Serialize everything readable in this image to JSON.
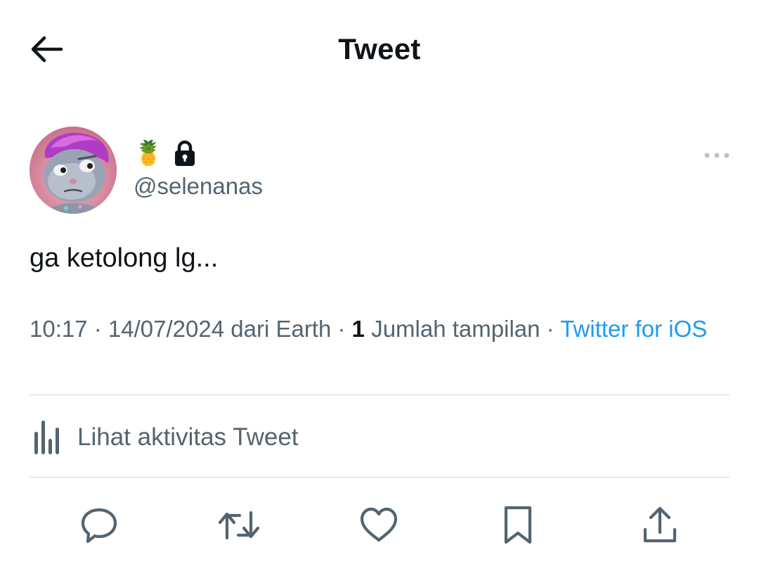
{
  "header": {
    "title": "Tweet",
    "back_icon": "arrow-left-icon"
  },
  "author": {
    "display_emoji": "🍍",
    "protected_icon": "lock-icon",
    "handle": "@selenanas",
    "more_icon": "more-horizontal-icon"
  },
  "tweet": {
    "text": "ga ketolong lg..."
  },
  "meta": {
    "time": "10:17",
    "sep1": " · ",
    "date": "14/07/2024",
    "from_label": " dari Earth",
    "sep2": " · ",
    "view_count": "1",
    "views_label": " Jumlah tampilan",
    "sep3": " · ",
    "source": "Twitter for iOS"
  },
  "activity": {
    "icon": "bar-chart-icon",
    "label": "Lihat aktivitas Tweet"
  },
  "actions": {
    "icons": [
      "reply-icon",
      "retweet-icon",
      "like-icon",
      "bookmark-icon",
      "share-icon"
    ]
  },
  "colors": {
    "text_primary": "#0f1419",
    "text_secondary": "#536471",
    "link": "#1d9bf0",
    "divider": "#cfd9de"
  }
}
